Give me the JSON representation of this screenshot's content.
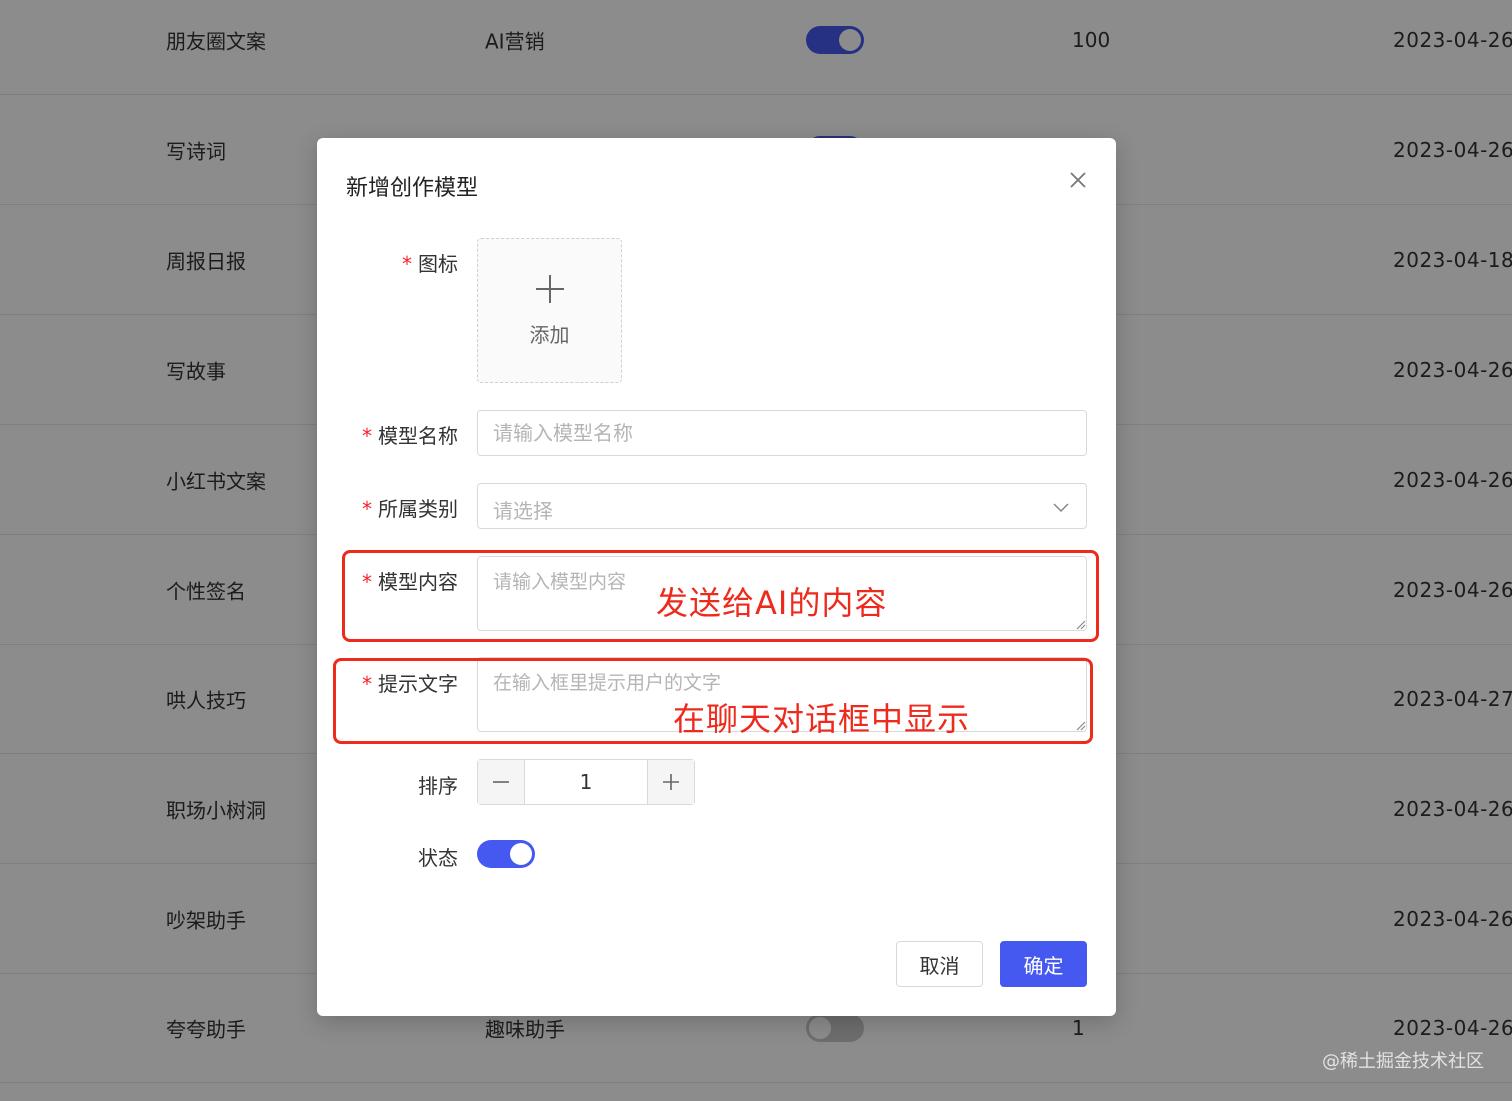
{
  "table": {
    "rows": [
      {
        "name": "朋友圈文案",
        "category": "AI营销",
        "switch_on": true,
        "order": "100",
        "date": "2023-04-26"
      },
      {
        "name": "写诗词",
        "category": "",
        "switch_on": true,
        "order": "",
        "date": "2023-04-26"
      },
      {
        "name": "周报日报",
        "category": "",
        "switch_on": true,
        "order": "",
        "date": "2023-04-18"
      },
      {
        "name": "写故事",
        "category": "",
        "switch_on": true,
        "order": "",
        "date": "2023-04-26"
      },
      {
        "name": "小红书文案",
        "category": "",
        "switch_on": true,
        "order": "",
        "date": "2023-04-26"
      },
      {
        "name": "个性签名",
        "category": "",
        "switch_on": true,
        "order": "",
        "date": "2023-04-26"
      },
      {
        "name": "哄人技巧",
        "category": "",
        "switch_on": true,
        "order": "",
        "date": "2023-04-27"
      },
      {
        "name": "职场小树洞",
        "category": "",
        "switch_on": true,
        "order": "",
        "date": "2023-04-26"
      },
      {
        "name": "吵架助手",
        "category": "",
        "switch_on": true,
        "order": "",
        "date": "2023-04-26"
      },
      {
        "name": "夸夸助手",
        "category": "趣味助手",
        "switch_on": false,
        "order": "1",
        "date": "2023-04-26"
      }
    ]
  },
  "watermark": "@稀土掘金技术社区",
  "modal": {
    "title": "新增创作模型",
    "close_icon": "close-icon",
    "fields": {
      "icon": {
        "label": "图标",
        "required": true,
        "upload_text": "添加"
      },
      "name": {
        "label": "模型名称",
        "required": true,
        "placeholder": "请输入模型名称"
      },
      "category": {
        "label": "所属类别",
        "required": true,
        "placeholder": "请选择"
      },
      "content": {
        "label": "模型内容",
        "required": true,
        "placeholder": "请输入模型内容"
      },
      "hint": {
        "label": "提示文字",
        "required": true,
        "placeholder": "在输入框里提示用户的文字"
      },
      "order": {
        "label": "排序",
        "value": "1"
      },
      "status": {
        "label": "状态",
        "on": true
      }
    },
    "annotations": {
      "content_note": "发送给AI的内容",
      "hint_note": "在聊天对话框中显示"
    },
    "buttons": {
      "cancel": "取消",
      "ok": "确定"
    }
  },
  "colors": {
    "primary": "#4559f0",
    "annotation": "#ee2a1d",
    "required": "#f5222d"
  }
}
